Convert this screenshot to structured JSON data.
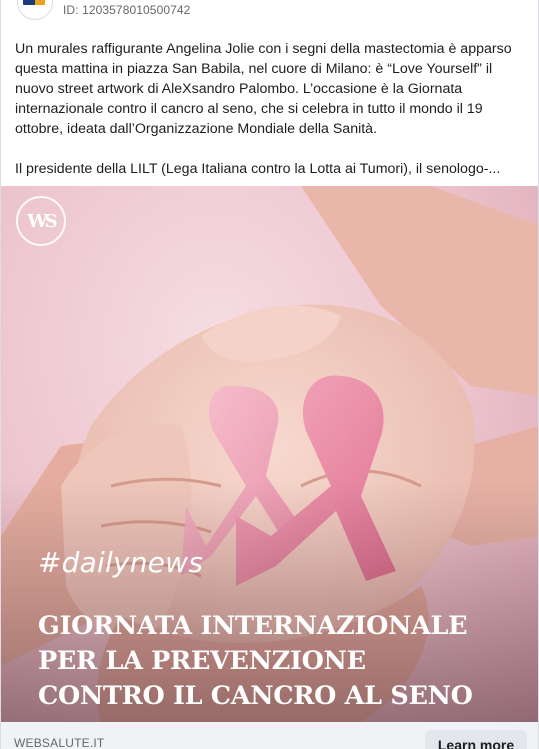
{
  "ad": {
    "id_label": "ID: 1203578010500742",
    "body_paragraphs": [
      "Un murales raffigurante Angelina Jolie con i segni della mastectomia è apparso questa mattina in piazza San Babila, nel cuore di Milano: è “Love Yourself” il nuovo street artwork di AleXsandro Palombo. L’occasione è la Giornata internazionale contro il cancro al seno, che si celebra in tutto il mondo il 19 ottobre, ideata dall’Organizzazione Mondiale della Sanità.",
      "Il presidente della LILT (Lega Italiana contro la Lotta ai Tumori), il senologo-..."
    ]
  },
  "creative": {
    "logo_text": "WS",
    "hashtag": "#dailynews",
    "headline_lines": [
      "GIORNATA INTERNAZIONALE",
      "PER LA PREVENZIONE",
      "CONTRO IL CANCRO AL SENO"
    ]
  },
  "footer": {
    "domain": "WEBSALUTE.IT",
    "cta_label": "Learn more"
  },
  "colors": {
    "ribbon_pink": "#f29bb3",
    "background_pink": "#ecc3cc",
    "text_muted": "#65676b"
  }
}
